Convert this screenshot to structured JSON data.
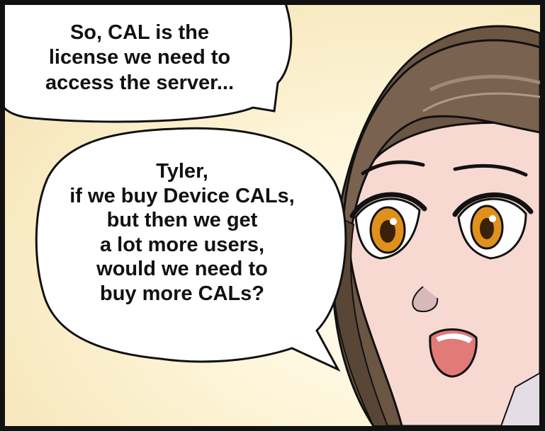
{
  "bubbles": [
    {
      "lines": [
        "So, CAL is the",
        "license we need to",
        "access the server..."
      ]
    },
    {
      "lines": [
        "Tyler,",
        "if we buy Device CALs,",
        "but then we get",
        "a lot more users,",
        "would we need to",
        "buy more CALs?"
      ]
    }
  ],
  "colors": {
    "background": "#fdf5d8",
    "hair": "#6b5644",
    "skin": "#f7d9d2",
    "iris": "#e0901c",
    "mouth": "#e27a78",
    "outline": "#111111"
  }
}
